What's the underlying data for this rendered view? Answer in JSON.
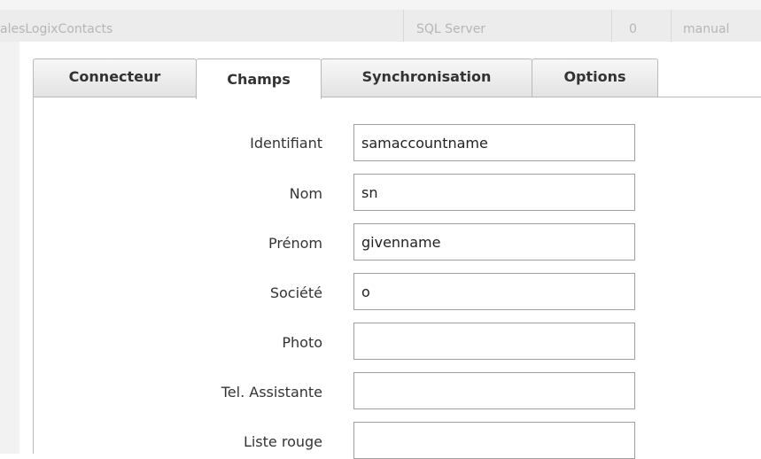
{
  "background_table": {
    "cells": [
      "alesLogixContacts",
      "SQL Server",
      "0",
      "manual"
    ]
  },
  "tabs": [
    {
      "label": "Connecteur",
      "active": false
    },
    {
      "label": "Champs",
      "active": true
    },
    {
      "label": "Synchronisation",
      "active": false
    },
    {
      "label": "Options",
      "active": false
    }
  ],
  "fields": [
    {
      "label": "Identifiant",
      "value": "samaccountname"
    },
    {
      "label": "Nom",
      "value": "sn"
    },
    {
      "label": "Prénom",
      "value": "givenname"
    },
    {
      "label": "Société",
      "value": "o"
    },
    {
      "label": "Photo",
      "value": ""
    },
    {
      "label": "Tel. Assistante",
      "value": ""
    },
    {
      "label": "Liste rouge",
      "value": ""
    }
  ]
}
